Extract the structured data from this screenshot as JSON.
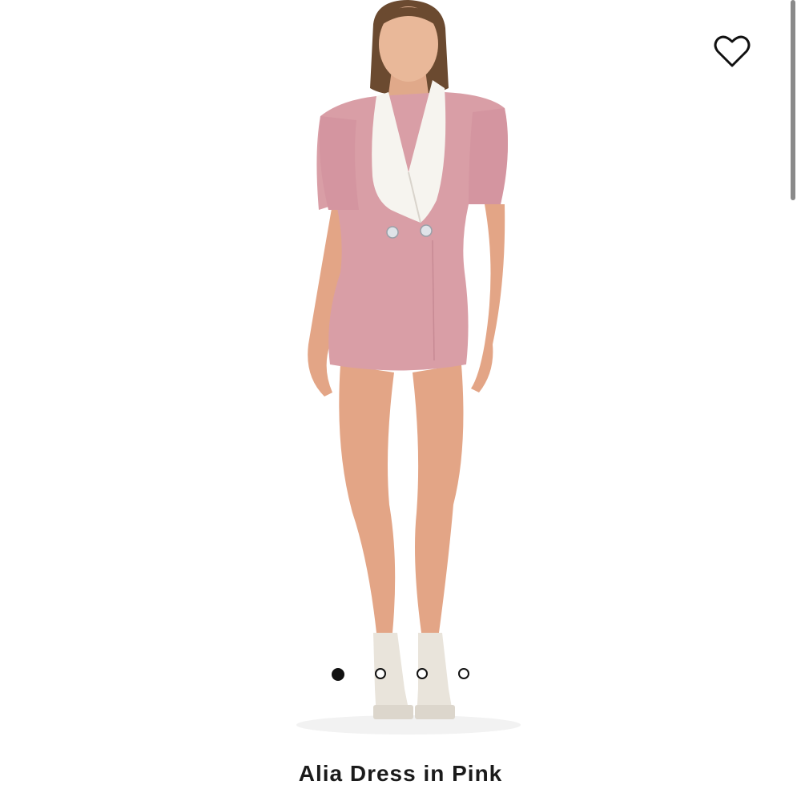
{
  "product": {
    "title": "Alia Dress in Pink",
    "color": "#d99ea6"
  },
  "gallery": {
    "total_images": 4,
    "active_index": 0
  },
  "icons": {
    "favorite": "heart-outline-icon"
  }
}
